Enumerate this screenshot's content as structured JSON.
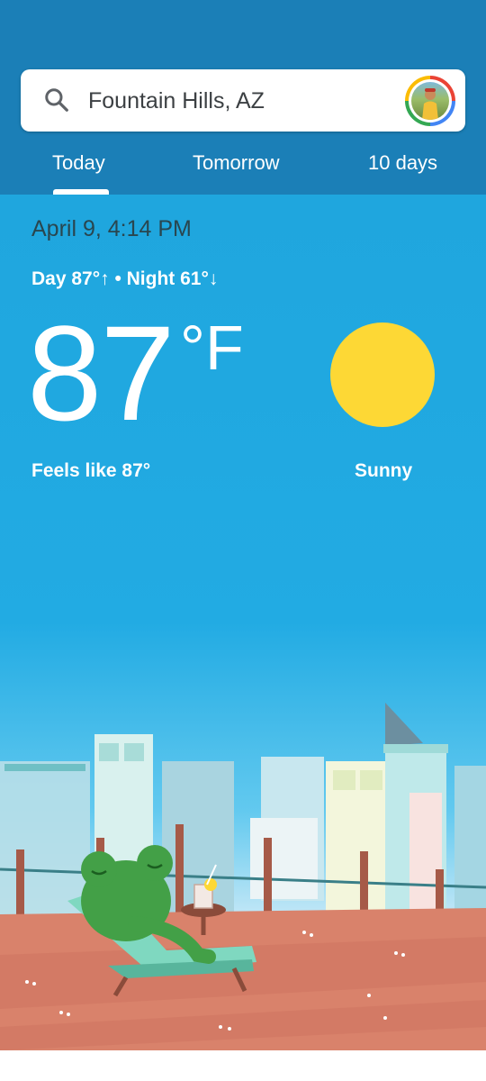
{
  "search": {
    "location": "Fountain Hills, AZ",
    "icon": "search-icon"
  },
  "tabs": [
    {
      "label": "Today",
      "selected": true
    },
    {
      "label": "Tomorrow",
      "selected": false
    },
    {
      "label": "10 days",
      "selected": false
    }
  ],
  "weather": {
    "datetime": "April 9, 4:14 PM",
    "day_night": "Day 87°↑ • Night 61°↓",
    "temperature": "87",
    "unit": "°F",
    "feels_like": "Feels like 87°",
    "condition": "Sunny",
    "condition_icon": "sun-icon"
  },
  "colors": {
    "header": "#1b7fb7",
    "sky": "#22abe3",
    "sun": "#fdd835",
    "frog": "#43a047"
  }
}
